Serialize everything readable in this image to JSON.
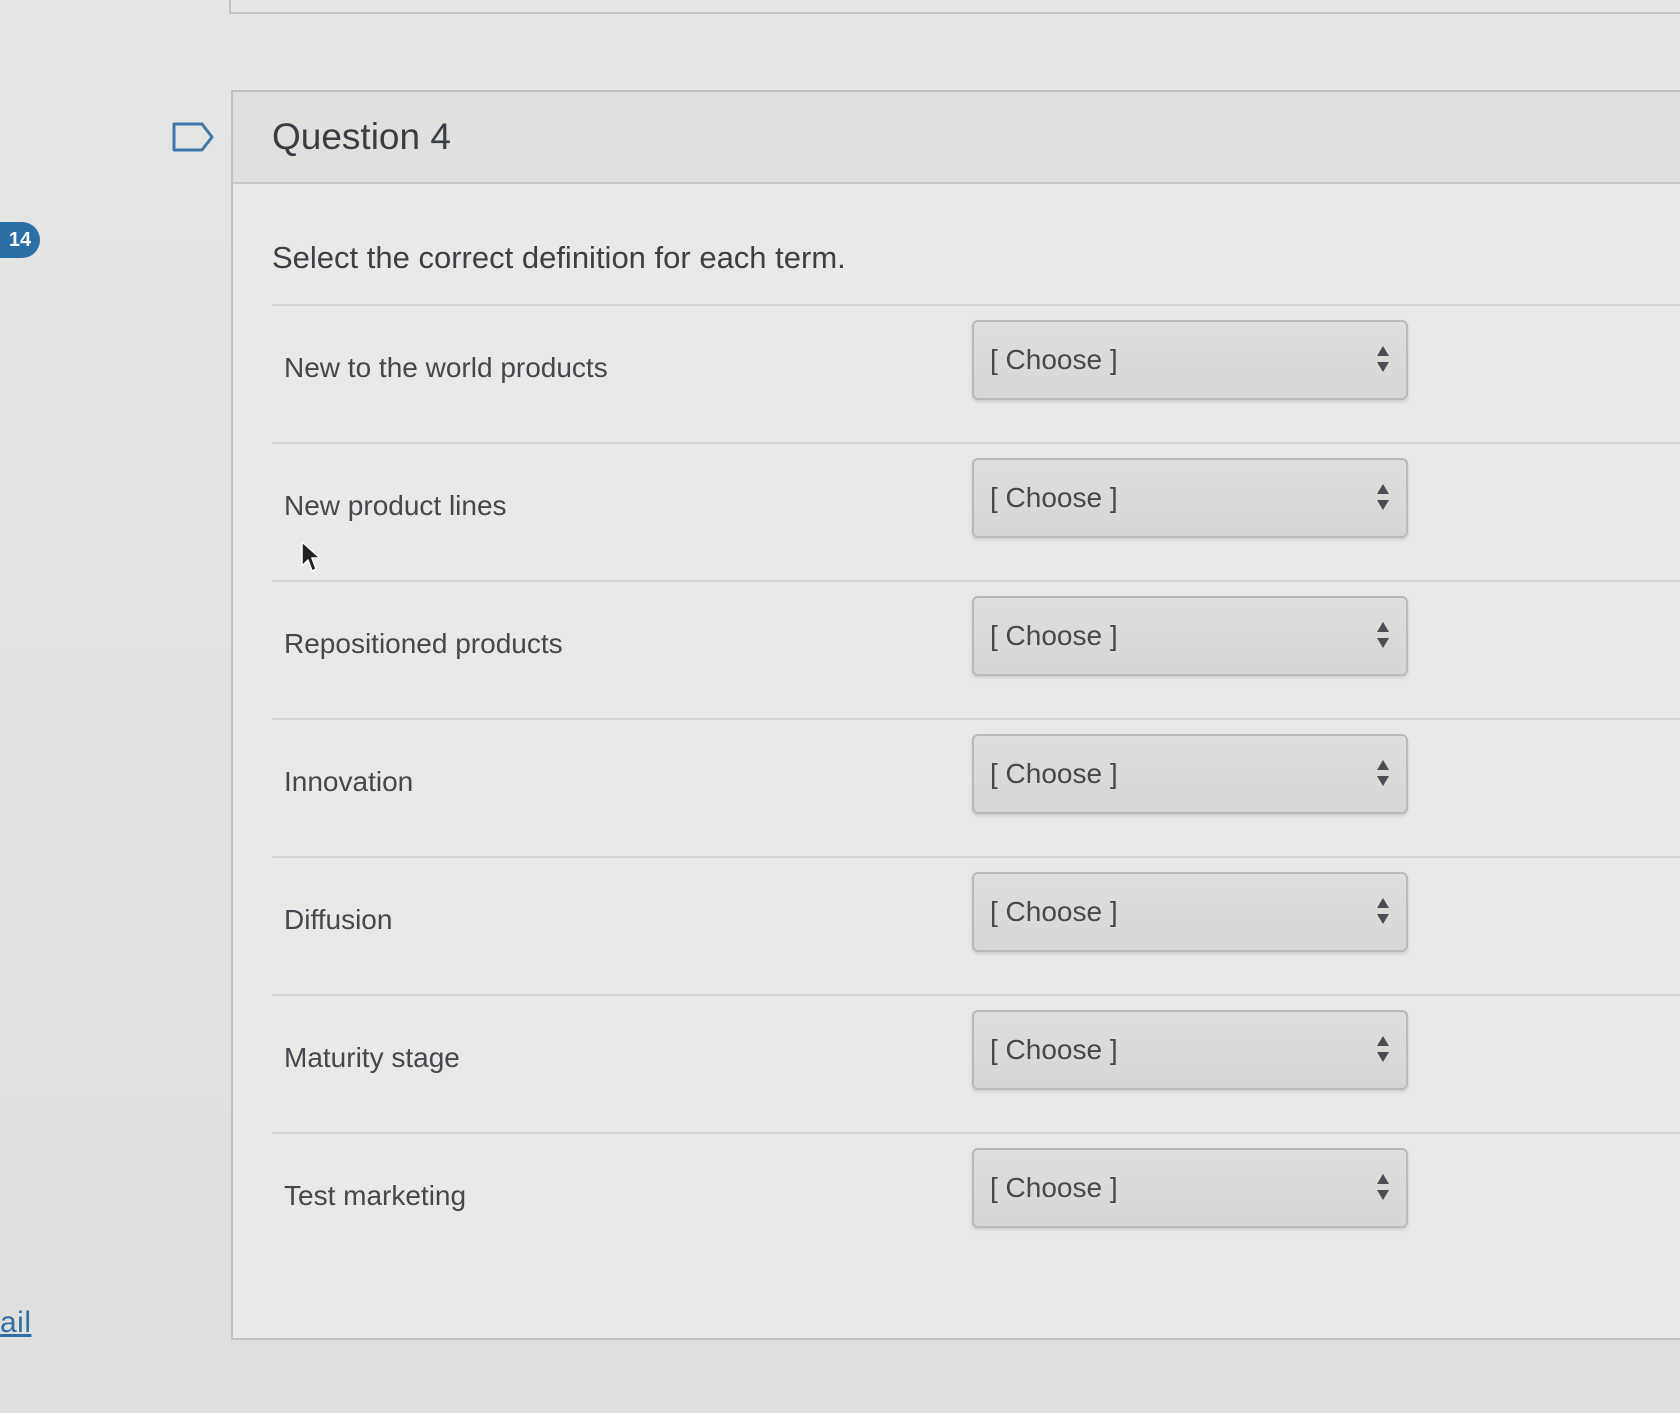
{
  "sidebar": {
    "badge_count": "14",
    "link_fragment": "ail"
  },
  "question": {
    "title": "Question 4",
    "instruction": "Select the correct definition for each term.",
    "rows": [
      {
        "term": "New to the world products",
        "select_value": "[ Choose ]"
      },
      {
        "term": "New product lines",
        "select_value": "[ Choose ]"
      },
      {
        "term": "Repositioned products",
        "select_value": "[ Choose ]"
      },
      {
        "term": "Innovation",
        "select_value": "[ Choose ]"
      },
      {
        "term": "Diffusion",
        "select_value": "[ Choose ]"
      },
      {
        "term": "Maturity stage",
        "select_value": "[ Choose ]"
      },
      {
        "term": "Test marketing",
        "select_value": "[ Choose ]"
      }
    ]
  },
  "icons": {
    "flag": "flag-outline-icon",
    "select_arrows": "up-down-arrows-icon",
    "cursor": "mouse-pointer-icon"
  },
  "colors": {
    "badge": "#2a6ea6",
    "link": "#2f6fa3",
    "background": "#e4e4e2"
  }
}
